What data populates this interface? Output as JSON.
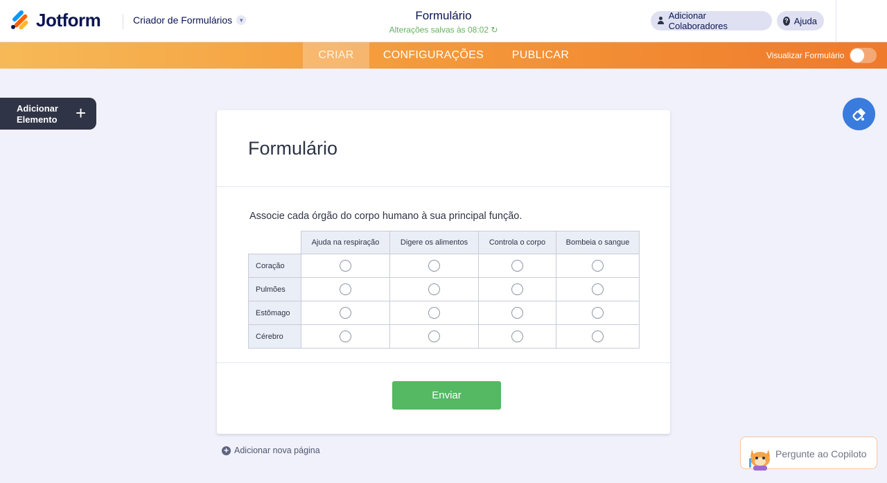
{
  "header": {
    "logo_text": "Jotform",
    "builder_title": "Criador de Formulários",
    "form_name": "Formulário",
    "save_status": "Alterações salvas às 08:02 ↻",
    "collab_label": "Adicionar Colaboradores",
    "help_label": "Ajuda"
  },
  "nav": {
    "tabs": [
      "CRIAR",
      "CONFIGURAÇÕES",
      "PUBLICAR"
    ],
    "active_tab": "CRIAR",
    "preview_label": "Visualizar Formulário",
    "preview_enabled": false
  },
  "sidebar": {
    "add_element_label": "Adicionar Elemento",
    "add_element_icon": "plus-icon"
  },
  "form": {
    "title": "Formulário",
    "question": "Associe cada órgão do corpo humano à sua principal função.",
    "columns": [
      "Ajuda na respiração",
      "Digere os alimentos",
      "Controla o corpo",
      "Bombeia o sangue"
    ],
    "rows": [
      "Coração",
      "Pulmões",
      "Estômago",
      "Cérebro"
    ],
    "submit_label": "Enviar"
  },
  "footer": {
    "add_page_label": "Adicionar nova página",
    "copilot_label": "Pergunte ao Copiloto"
  },
  "colors": {
    "nav_start": "#f7b957",
    "nav_end": "#ef7a2b",
    "submit": "#55b862",
    "paint_button": "#3a7bde",
    "status_green": "#64b05e"
  }
}
